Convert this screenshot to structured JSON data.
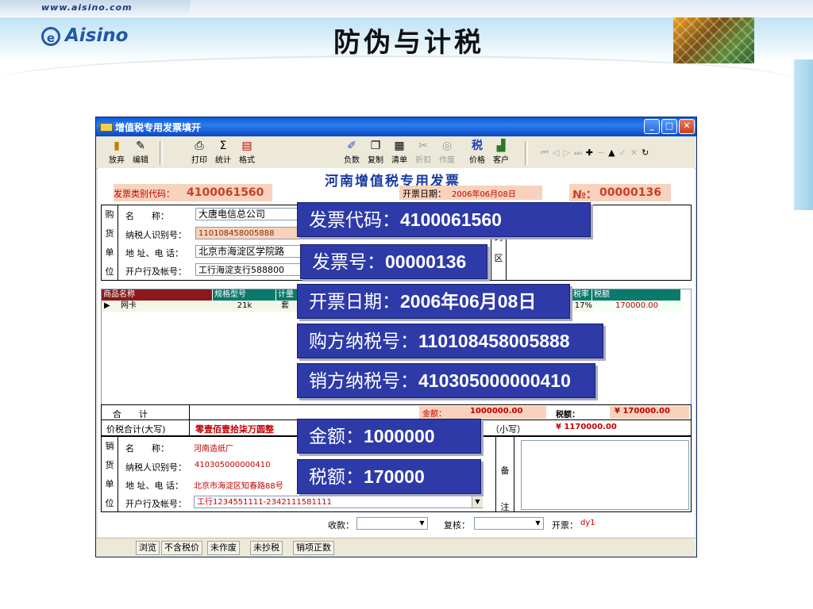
{
  "slide": {
    "url": "www.aisino.com",
    "logo": "Aisino",
    "title": "防伪与计税"
  },
  "window": {
    "title": "增值税专用发票填开",
    "invoice_heading": "河南增值税专用发票",
    "toolbar": [
      {
        "label": "放弃",
        "icon": "door-icon"
      },
      {
        "label": "编辑",
        "icon": "edit-icon"
      },
      {
        "label": "打印",
        "icon": "printer-icon"
      },
      {
        "label": "统计",
        "icon": "sigma-icon"
      },
      {
        "label": "格式",
        "icon": "format-icon"
      },
      {
        "label": "负数",
        "icon": "negative-icon"
      },
      {
        "label": "复制",
        "icon": "copy-icon"
      },
      {
        "label": "清单",
        "icon": "list-icon"
      },
      {
        "label": "折扣",
        "icon": "discount-icon"
      },
      {
        "label": "作废",
        "icon": "void-icon"
      },
      {
        "label": "价格",
        "icon": "tax-icon"
      },
      {
        "label": "客户",
        "icon": "chart-icon"
      }
    ],
    "invoice_type_code_label": "发票类别代码：",
    "invoice_type_code": "4100061560",
    "issue_date_label": "开票日期：",
    "issue_date": "2006年06月08日",
    "no_label": "№：",
    "invoice_no": "00000136",
    "buyer": {
      "side": [
        "购",
        "货",
        "单",
        "位"
      ],
      "name_label": "名　　称：",
      "name": "大唐电信总公司",
      "taxid_label": "纳税人识别号：",
      "taxid": "110108458005888",
      "addr_label": "地 址、电 话：",
      "addr": "北京市海淀区学院路",
      "bank_label": "开户行及帐号：",
      "bank": "工行海淀支行588800",
      "code_area": [
        "码",
        "区"
      ]
    },
    "grid": {
      "headers": [
        "商品名称",
        "规格型号",
        "计量",
        "税率",
        "税额"
      ],
      "row": {
        "name": "网卡",
        "spec": "21k",
        "unit": "套",
        "rate": "17%",
        "tax": "170000.00"
      }
    },
    "totals": {
      "total_label": "合　　计",
      "amount_label": "金额：",
      "amount": "1000000.00",
      "tax_label": "税额：",
      "tax": "¥ 170000.00",
      "in_words_label": "价税合计(大写)",
      "in_words": "零壹佰壹拾柒万圆整",
      "small_label": "（小写）",
      "small_value": "¥ 1170000.00"
    },
    "seller": {
      "side": [
        "销",
        "货",
        "单",
        "位"
      ],
      "name_label": "名　　称：",
      "name": "河南造纸厂",
      "taxid_label": "纳税人识别号：",
      "taxid": "410305000000410",
      "addr_label": "地 址、电 话：",
      "addr": "北京市海淀区知春路88号",
      "bank_label": "开户行及帐号：",
      "bank": "工行1234551111-2342111581111",
      "remark": [
        "备",
        "注"
      ]
    },
    "bottom": {
      "payee_label": "收款：",
      "reviewer_label": "复核：",
      "issuer_label": "开票：",
      "issuer": "dy1"
    },
    "status": [
      "浏览",
      "不含税价",
      "未作废",
      "未抄税",
      "销项正数"
    ]
  },
  "callouts": [
    {
      "label": "发票代码：",
      "value": "4100061560"
    },
    {
      "label": "发票号：",
      "value": "00000136"
    },
    {
      "label": "开票日期：",
      "value": "2006年06月08日"
    },
    {
      "label": "购方纳税号：",
      "value": "110108458005888"
    },
    {
      "label": "销方纳税号：",
      "value": "410305000000410"
    },
    {
      "label": "金额：",
      "value": "1000000"
    },
    {
      "label": "税额：",
      "value": "170000"
    }
  ]
}
